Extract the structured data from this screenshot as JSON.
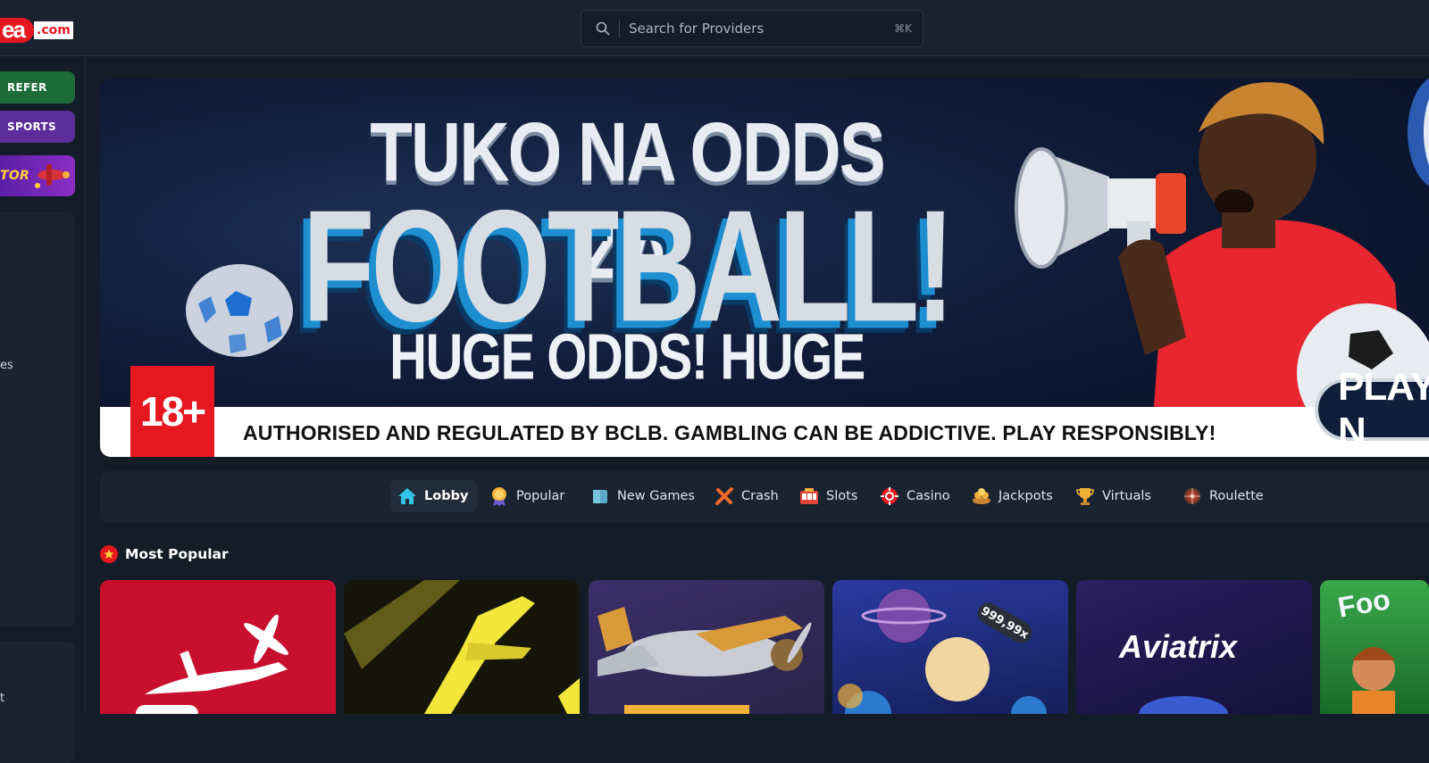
{
  "header": {
    "logo_text": "ea",
    "logo_suffix": ".com",
    "search_placeholder": "Search for Providers",
    "search_shortcut": "⌘K"
  },
  "sidebar": {
    "refer_label": "REFER",
    "sports_label": "SPORTS",
    "aviator_label": "TOR",
    "fragment_1": "es",
    "fragment_2": "t"
  },
  "banner": {
    "headline_top": "TUKO NA ODDS ZA",
    "headline_main": "FOOTBALL!",
    "headline_sub": "HUGE ODDS! HUGE WINS!!!",
    "age_badge": "18+",
    "disclaimer": "AUTHORISED AND REGULATED BY BCLB. GAMBLING CAN BE ADDICTIVE. PLAY RESPONSIBLY!",
    "play_label": "PLAY N"
  },
  "categories": [
    {
      "label": "Lobby",
      "icon": "home-icon",
      "active": true
    },
    {
      "label": "Popular",
      "icon": "medal-icon",
      "active": false
    },
    {
      "label": "New Games",
      "icon": "new-box-icon",
      "active": false
    },
    {
      "label": "Crash",
      "icon": "crash-icon",
      "active": false
    },
    {
      "label": "Slots",
      "icon": "slot-machine-icon",
      "active": false
    },
    {
      "label": "Casino",
      "icon": "casino-chip-icon",
      "active": false
    },
    {
      "label": "Jackpots",
      "icon": "jackpot-icon",
      "active": false
    },
    {
      "label": "Virtuals",
      "icon": "trophy-icon",
      "active": false
    },
    {
      "label": "Roulette",
      "icon": "roulette-icon",
      "active": false
    }
  ],
  "section": {
    "title": "Most Popular"
  },
  "games": [
    {
      "title": "",
      "bg": "#c8102e"
    },
    {
      "title": "",
      "bg": "#1a1a0a"
    },
    {
      "title": "",
      "bg": "#2a2a55"
    },
    {
      "title": "999,99x",
      "bg": "#1f2a7a"
    },
    {
      "title": "Aviatrix",
      "bg": "#1c1550"
    },
    {
      "title": "Foo",
      "bg": "#1f8a3a"
    }
  ],
  "colors": {
    "brand_red": "#e5171f",
    "bg": "#141c27",
    "panel": "#1a2330"
  }
}
